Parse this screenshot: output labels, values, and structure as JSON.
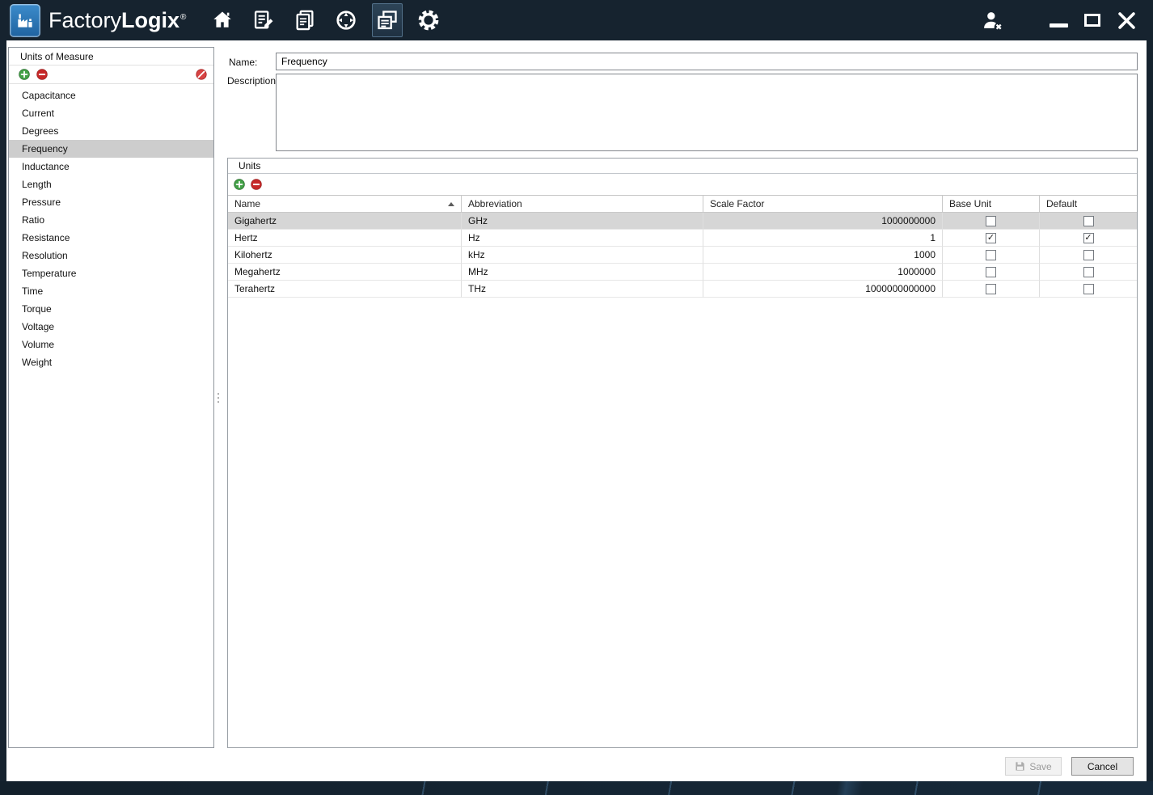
{
  "titlebar": {
    "brand": {
      "part1": "Factory",
      "part2": "Logix",
      "reg": "®"
    },
    "nav_icons": [
      "home",
      "document-edit",
      "stacked-documents",
      "compass",
      "dashboard",
      "settings-gear"
    ],
    "active_nav_icon": "dashboard",
    "window_controls": [
      "user-signout",
      "minimize",
      "maximize",
      "close"
    ]
  },
  "sidebar": {
    "title": "Units of Measure",
    "items": [
      "Capacitance",
      "Current",
      "Degrees",
      "Frequency",
      "Inductance",
      "Length",
      "Pressure",
      "Ratio",
      "Resistance",
      "Resolution",
      "Temperature",
      "Time",
      "Torque",
      "Voltage",
      "Volume",
      "Weight"
    ],
    "selected_item": "Frequency"
  },
  "detail": {
    "name_label": "Name:",
    "name_value": "Frequency",
    "description_label": "Description:",
    "description_value": ""
  },
  "units": {
    "title": "Units",
    "columns": [
      "Name",
      "Abbreviation",
      "Scale Factor",
      "Base Unit",
      "Default"
    ],
    "sort_column": "Name",
    "sort_direction": "ascending",
    "selected_row": "Gigahertz",
    "rows": [
      {
        "name": "Gigahertz",
        "abbr": "GHz",
        "scale": "1000000000",
        "base_unit": false,
        "default": false
      },
      {
        "name": "Hertz",
        "abbr": "Hz",
        "scale": "1",
        "base_unit": true,
        "default": true
      },
      {
        "name": "Kilohertz",
        "abbr": "kHz",
        "scale": "1000",
        "base_unit": false,
        "default": false
      },
      {
        "name": "Megahertz",
        "abbr": "MHz",
        "scale": "1000000",
        "base_unit": false,
        "default": false
      },
      {
        "name": "Terahertz",
        "abbr": "THz",
        "scale": "1000000000000",
        "base_unit": false,
        "default": false
      }
    ]
  },
  "footer": {
    "save": "Save",
    "cancel": "Cancel"
  },
  "colors": {
    "titlebar_bg": "#16232f",
    "logo_blue": "#2e7fc2",
    "selected_row": "#d6d6d6",
    "selected_sidebar_item": "#cdcdcd",
    "add_green": "#43a047",
    "remove_red": "#c62828"
  }
}
